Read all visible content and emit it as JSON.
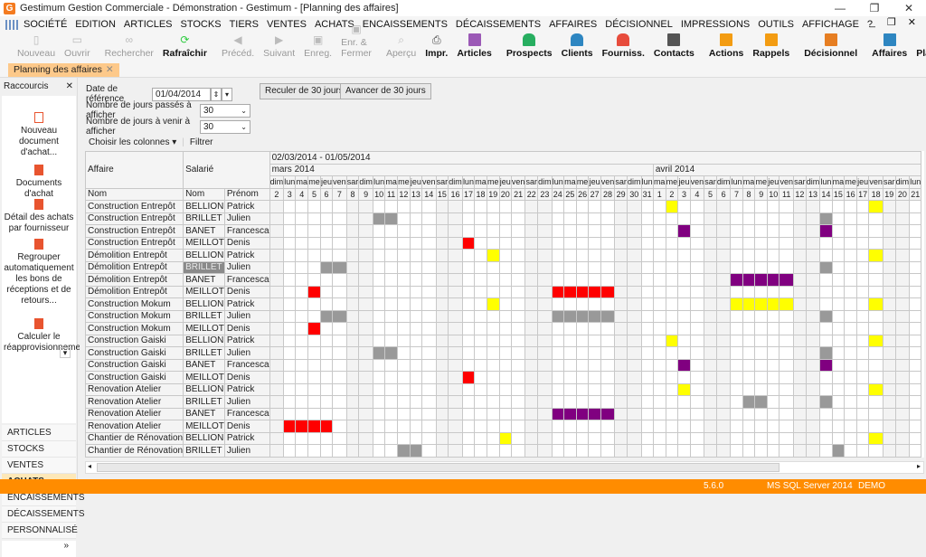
{
  "window": {
    "title": "Gestimum Gestion Commerciale - Démonstration - Gestimum - [Planning des affaires]",
    "logo": "G",
    "controls": [
      "—",
      "❐",
      "✕"
    ]
  },
  "menu": [
    "SOCIÉTÉ",
    "EDITION",
    "ARTICLES",
    "STOCKS",
    "TIERS",
    "VENTES",
    "ACHATS",
    "ENCAISSEMENTS",
    "DÉCAISSEMENTS",
    "AFFAIRES",
    "DÉCISIONNEL",
    "IMPRESSIONS",
    "OUTILS",
    "AFFICHAGE",
    "?"
  ],
  "mdi_controls": "_ ❐ ✕",
  "toolbar": [
    {
      "label": "Nouveau",
      "icon": "new-doc-icon",
      "enabled": false
    },
    {
      "label": "Ouvrir",
      "icon": "folder-icon",
      "enabled": false
    },
    {
      "label": "Rechercher",
      "icon": "binoculars-icon",
      "enabled": false
    },
    {
      "label": "Rafraîchir",
      "icon": "refresh-icon",
      "enabled": true
    },
    {
      "label": "Précéd.",
      "icon": "prev-icon",
      "enabled": false
    },
    {
      "label": "Suivant",
      "icon": "next-icon",
      "enabled": false
    },
    {
      "label": "Enreg.",
      "icon": "save-icon",
      "enabled": false
    },
    {
      "label": "Enr. & Fermer",
      "icon": "save-close-icon",
      "enabled": false
    },
    {
      "label": "Aperçu",
      "icon": "preview-icon",
      "enabled": false
    },
    {
      "label": "Impr.",
      "icon": "print-icon",
      "enabled": true
    }
  ],
  "toolbar_right": [
    {
      "label": "Articles",
      "icon": "articles-icon",
      "color": "#9b59b6"
    },
    {
      "label": "Prospects",
      "icon": "prospects-icon",
      "color": "#27ae60"
    },
    {
      "label": "Clients",
      "icon": "clients-icon",
      "color": "#2e86c1"
    },
    {
      "label": "Fourniss.",
      "icon": "suppliers-icon",
      "color": "#e74c3c"
    },
    {
      "label": "Contacts",
      "icon": "contacts-icon",
      "color": "#555555"
    },
    {
      "label": "Actions",
      "icon": "actions-icon",
      "color": "#f39c12"
    },
    {
      "label": "Rappels",
      "icon": "bell-icon",
      "color": "#f39c12"
    },
    {
      "label": "Décisionnel",
      "icon": "pie-chart-icon",
      "color": "#e67e22"
    },
    {
      "label": "Affaires",
      "icon": "affaires-icon",
      "color": "#2e86c1"
    },
    {
      "label": "Planning",
      "icon": "planning-icon",
      "color": "#2e86c1"
    }
  ],
  "tab": {
    "label": "Planning des affaires",
    "close": "✕"
  },
  "sidebar": {
    "title": "Raccourcis",
    "close": "✕",
    "shortcuts": [
      "Nouveau document d'achat...",
      "Documents d'achat",
      "Détail des achats par fournisseur",
      "Regrouper automatiquement les bons de réceptions et de retours...",
      "Calculer le réapprovisionneme..."
    ],
    "nav": [
      "ARTICLES",
      "STOCKS",
      "VENTES",
      "ACHATS",
      "ENCAISSEMENTS",
      "DÉCAISSEMENTS",
      "PERSONNALISÉ"
    ],
    "active_nav": "ACHATS",
    "more": "»"
  },
  "form": {
    "ref_date_label": "Date de référence",
    "ref_date": "01/04/2014",
    "past_days_label": "Nombre de jours passés à afficher",
    "past_days": "30",
    "future_days_label": "Nombre de jours à venir à afficher",
    "future_days": "30",
    "back_button": "Reculer de 30 jours",
    "forward_button": "Avancer de 30 jours",
    "choose_columns": "Choisir les colonnes ▾",
    "filter": "Filtrer"
  },
  "grid": {
    "range": "02/03/2014 - 01/05/2014",
    "group_affaire": "Affaire",
    "group_salarie": "Salarié",
    "col_nom": "Nom",
    "col_salarie_nom": "Nom",
    "col_prenom": "Prénom",
    "months": [
      {
        "label": "mars 2014",
        "days": 30
      },
      {
        "label": "avril 2014",
        "days": 21
      }
    ],
    "days": [
      {
        "d": "dim",
        "n": 2
      },
      {
        "d": "lun",
        "n": 3
      },
      {
        "d": "ma",
        "n": 4
      },
      {
        "d": "me",
        "n": 5
      },
      {
        "d": "jeu",
        "n": 6
      },
      {
        "d": "ven",
        "n": 7
      },
      {
        "d": "sar",
        "n": 8
      },
      {
        "d": "dim",
        "n": 9
      },
      {
        "d": "lun",
        "n": 10
      },
      {
        "d": "ma",
        "n": 11
      },
      {
        "d": "me",
        "n": 12
      },
      {
        "d": "jeu",
        "n": 13
      },
      {
        "d": "ven",
        "n": 14
      },
      {
        "d": "sar",
        "n": 15
      },
      {
        "d": "dim",
        "n": 16
      },
      {
        "d": "lun",
        "n": 17
      },
      {
        "d": "ma",
        "n": 18
      },
      {
        "d": "me",
        "n": 19
      },
      {
        "d": "jeu",
        "n": 20
      },
      {
        "d": "ven",
        "n": 21
      },
      {
        "d": "sar",
        "n": 22
      },
      {
        "d": "dim",
        "n": 23
      },
      {
        "d": "lun",
        "n": 24
      },
      {
        "d": "ma",
        "n": 25
      },
      {
        "d": "me",
        "n": 26
      },
      {
        "d": "jeu",
        "n": 27
      },
      {
        "d": "ven",
        "n": 28
      },
      {
        "d": "sar",
        "n": 29
      },
      {
        "d": "dim",
        "n": 30
      },
      {
        "d": "lun",
        "n": 31
      },
      {
        "d": "ma",
        "n": 1
      },
      {
        "d": "me",
        "n": 2
      },
      {
        "d": "jeu",
        "n": 3
      },
      {
        "d": "ven",
        "n": 4
      },
      {
        "d": "sar",
        "n": 5
      },
      {
        "d": "dim",
        "n": 6
      },
      {
        "d": "lun",
        "n": 7
      },
      {
        "d": "ma",
        "n": 8
      },
      {
        "d": "me",
        "n": 9
      },
      {
        "d": "jeu",
        "n": 10
      },
      {
        "d": "ven",
        "n": 11
      },
      {
        "d": "sar",
        "n": 12
      },
      {
        "d": "dim",
        "n": 13
      },
      {
        "d": "lun",
        "n": 14
      },
      {
        "d": "ma",
        "n": 15
      },
      {
        "d": "me",
        "n": 16
      },
      {
        "d": "jeu",
        "n": 17
      },
      {
        "d": "ven",
        "n": 18
      },
      {
        "d": "sar",
        "n": 19
      },
      {
        "d": "dim",
        "n": 20
      },
      {
        "d": "lun",
        "n": 21
      }
    ],
    "colors": {
      "yellow": "#ffff00",
      "grey": "#999999",
      "red": "#ff0000",
      "purple": "#800080"
    },
    "rows": [
      {
        "affaire": "Construction Entrepôt",
        "nom": "BELLION",
        "prenom": "Patrick",
        "marks": {
          "31": "yellow",
          "47": "yellow"
        }
      },
      {
        "affaire": "Construction Entrepôt",
        "nom": "BRILLET",
        "prenom": "Julien",
        "marks": {
          "8": "grey",
          "9": "grey",
          "43": "grey"
        }
      },
      {
        "affaire": "Construction Entrepôt",
        "nom": "BANET",
        "prenom": "Francesca",
        "marks": {
          "32": "purple",
          "43": "purple"
        }
      },
      {
        "affaire": "Construction Entrepôt",
        "nom": "MEILLOT",
        "prenom": "Denis",
        "marks": {
          "15": "red"
        }
      },
      {
        "affaire": "Démolition Entrepôt",
        "nom": "BELLION",
        "prenom": "Patrick",
        "marks": {
          "17": "yellow",
          "47": "yellow"
        }
      },
      {
        "affaire": "Démolition Entrepôt",
        "nom": "BRILLET",
        "prenom": "Julien",
        "selected": true,
        "marks": {
          "4": "grey",
          "5": "grey",
          "43": "grey"
        }
      },
      {
        "affaire": "Démolition Entrepôt",
        "nom": "BANET",
        "prenom": "Francesca",
        "marks": {
          "36": "purple",
          "37": "purple",
          "38": "purple",
          "39": "purple",
          "40": "purple"
        }
      },
      {
        "affaire": "Démolition Entrepôt",
        "nom": "MEILLOT",
        "prenom": "Denis",
        "marks": {
          "3": "red",
          "22": "red",
          "23": "red",
          "24": "red",
          "25": "red",
          "26": "red"
        }
      },
      {
        "affaire": "Construction Mokum",
        "nom": "BELLION",
        "prenom": "Patrick",
        "marks": {
          "17": "yellow",
          "36": "yellow",
          "37": "yellow",
          "38": "yellow",
          "39": "yellow",
          "40": "yellow",
          "47": "yellow"
        }
      },
      {
        "affaire": "Construction Mokum",
        "nom": "BRILLET",
        "prenom": "Julien",
        "marks": {
          "4": "grey",
          "5": "grey",
          "22": "grey",
          "23": "grey",
          "24": "grey",
          "25": "grey",
          "26": "grey",
          "43": "grey"
        }
      },
      {
        "affaire": "Construction Mokum",
        "nom": "MEILLOT",
        "prenom": "Denis",
        "marks": {
          "3": "red"
        }
      },
      {
        "affaire": "Construction Gaiski",
        "nom": "BELLION",
        "prenom": "Patrick",
        "marks": {
          "31": "yellow",
          "47": "yellow"
        }
      },
      {
        "affaire": "Construction Gaiski",
        "nom": "BRILLET",
        "prenom": "Julien",
        "marks": {
          "8": "grey",
          "9": "grey",
          "43": "grey"
        }
      },
      {
        "affaire": "Construction Gaiski",
        "nom": "BANET",
        "prenom": "Francesca",
        "marks": {
          "32": "purple",
          "43": "purple"
        }
      },
      {
        "affaire": "Construction Gaiski",
        "nom": "MEILLOT",
        "prenom": "Denis",
        "marks": {
          "15": "red"
        }
      },
      {
        "affaire": "Renovation Atelier",
        "nom": "BELLION",
        "prenom": "Patrick",
        "marks": {
          "32": "yellow",
          "47": "yellow"
        }
      },
      {
        "affaire": "Renovation Atelier",
        "nom": "BRILLET",
        "prenom": "Julien",
        "marks": {
          "37": "grey",
          "38": "grey",
          "43": "grey"
        }
      },
      {
        "affaire": "Renovation Atelier",
        "nom": "BANET",
        "prenom": "Francesca",
        "marks": {
          "22": "purple",
          "23": "purple",
          "24": "purple",
          "25": "purple",
          "26": "purple"
        }
      },
      {
        "affaire": "Renovation Atelier",
        "nom": "MEILLOT",
        "prenom": "Denis",
        "marks": {
          "1": "red",
          "2": "red",
          "3": "red",
          "4": "red"
        }
      },
      {
        "affaire": "Chantier de Rénovation",
        "nom": "BELLION",
        "prenom": "Patrick",
        "marks": {
          "18": "yellow",
          "47": "yellow"
        }
      },
      {
        "affaire": "Chantier de Rénovation",
        "nom": "BRILLET",
        "prenom": "Julien",
        "marks": {
          "10": "grey",
          "11": "grey",
          "44": "grey"
        }
      }
    ]
  },
  "statusbar": {
    "version": "5.6.0",
    "db": "MS SQL Server 2014",
    "mode": "DEMO"
  }
}
